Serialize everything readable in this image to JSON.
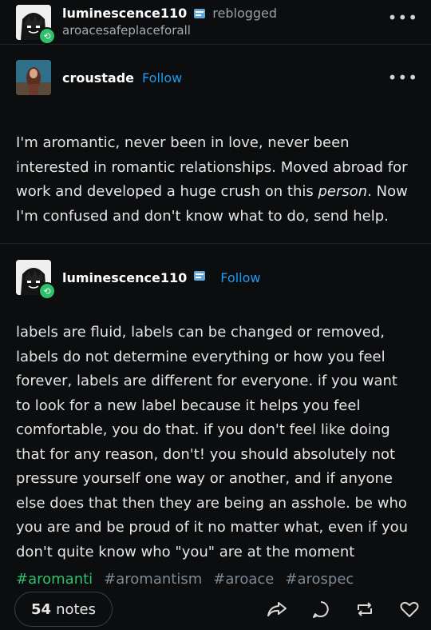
{
  "reblog_header": {
    "username": "luminescence110",
    "action": "reblogged",
    "source": "aroacesafeplaceforall",
    "menu_icon": "more-dots-icon"
  },
  "op_post": {
    "username": "croustade",
    "follow_label": "Follow",
    "text_before": "I'm aromantic, never been in love, never been interested in romantic relationships. Moved abroad for work and developed a huge crush on this ",
    "text_em": "person",
    "text_after": ". Now I'm confused and don't know what to do, send help."
  },
  "reply_post": {
    "username": "luminescence110",
    "follow_label": "Follow",
    "text": "labels are fluid, labels can be changed or removed, labels do not determine everything or how you feel forever, labels are different for everyone. if you want to look for a new label because it helps you feel comfortable, you do that. if you don't feel like doing that for any reason, don't! you should absolutely not pressure yourself one way or another, and if anyone else does that then they are being an asshole. be who you are and be proud of it no matter what, even if you don't quite know who \"you\" are at the moment"
  },
  "tags": [
    "#aromanti",
    "#aromantism",
    "#aroace",
    "#arospec"
  ],
  "footer": {
    "notes_count": "54",
    "notes_label": "notes",
    "icons": [
      "share-icon",
      "reply-icon",
      "reblog-icon",
      "like-icon"
    ]
  },
  "colors": {
    "background": "#0b0d0f",
    "follow": "#1e9bf0",
    "reblog_badge": "#2ec06b",
    "tag": "#7d8a94"
  }
}
